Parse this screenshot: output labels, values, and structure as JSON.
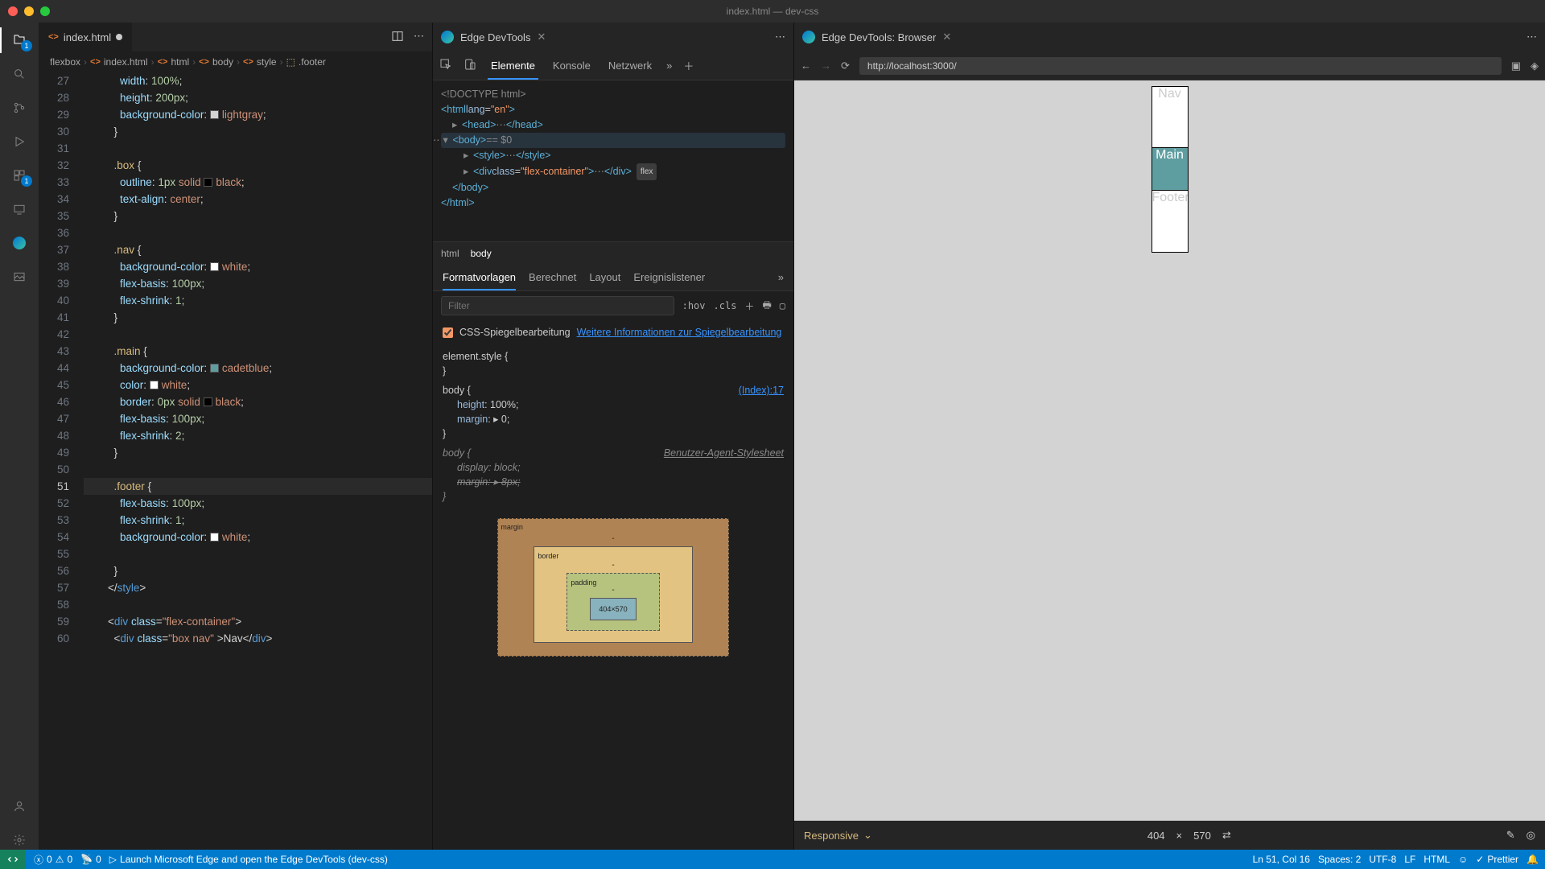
{
  "window": {
    "title": "index.html — dev-css"
  },
  "activity": {
    "explorer_badge": "1",
    "ext_badge": "1"
  },
  "editor": {
    "tab": {
      "icon": "<>",
      "name": "index.html"
    },
    "actions": {
      "split": "▢",
      "more": "⋯"
    },
    "breadcrumbs": [
      "flexbox",
      "index.html",
      "html",
      "body",
      "style",
      ".footer"
    ],
    "lines": [
      {
        "n": 27,
        "html": "            <span class='k'>width</span><span class='p'>: </span><span class='n'>100%</span><span class='p'>;</span>"
      },
      {
        "n": 28,
        "html": "            <span class='k'>height</span><span class='p'>: </span><span class='n'>200px</span><span class='p'>;</span>"
      },
      {
        "n": 29,
        "html": "            <span class='k'>background-color</span><span class='p'>: </span><span class='sw' style='background:lightgray'></span><span class='cm'>lightgray</span><span class='p'>;</span>"
      },
      {
        "n": 30,
        "html": "          <span class='p'>}</span>"
      },
      {
        "n": 31,
        "html": ""
      },
      {
        "n": 32,
        "html": "          <span class='sel'>.box</span> <span class='p'>{</span>"
      },
      {
        "n": 33,
        "html": "            <span class='k'>outline</span><span class='p'>: </span><span class='n'>1px</span> <span class='cm'>solid</span> <span class='sw' style='background:black'></span><span class='cm'>black</span><span class='p'>;</span>"
      },
      {
        "n": 34,
        "html": "            <span class='k'>text-align</span><span class='p'>: </span><span class='cm'>center</span><span class='p'>;</span>"
      },
      {
        "n": 35,
        "html": "          <span class='p'>}</span>"
      },
      {
        "n": 36,
        "html": ""
      },
      {
        "n": 37,
        "html": "          <span class='sel'>.nav</span> <span class='p'>{</span>"
      },
      {
        "n": 38,
        "html": "            <span class='k'>background-color</span><span class='p'>: </span><span class='sw' style='background:white'></span><span class='cm'>white</span><span class='p'>;</span>"
      },
      {
        "n": 39,
        "html": "            <span class='k'>flex-basis</span><span class='p'>: </span><span class='n'>100px</span><span class='p'>;</span>"
      },
      {
        "n": 40,
        "html": "            <span class='k'>flex-shrink</span><span class='p'>: </span><span class='n'>1</span><span class='p'>;</span>"
      },
      {
        "n": 41,
        "html": "          <span class='p'>}</span>"
      },
      {
        "n": 42,
        "html": ""
      },
      {
        "n": 43,
        "html": "          <span class='sel'>.main</span> <span class='p'>{</span>"
      },
      {
        "n": 44,
        "html": "            <span class='k'>background-color</span><span class='p'>: </span><span class='sw' style='background:cadetblue'></span><span class='cm'>cadetblue</span><span class='p'>;</span>"
      },
      {
        "n": 45,
        "html": "            <span class='k'>color</span><span class='p'>: </span><span class='sw' style='background:white'></span><span class='cm'>white</span><span class='p'>;</span>"
      },
      {
        "n": 46,
        "html": "            <span class='k'>border</span><span class='p'>: </span><span class='n'>0px</span> <span class='cm'>solid</span> <span class='sw' style='background:black'></span><span class='cm'>black</span><span class='p'>;</span>"
      },
      {
        "n": 47,
        "html": "            <span class='k'>flex-basis</span><span class='p'>: </span><span class='n'>100px</span><span class='p'>;</span>"
      },
      {
        "n": 48,
        "html": "            <span class='k'>flex-shrink</span><span class='p'>: </span><span class='n'>2</span><span class='p'>;</span>"
      },
      {
        "n": 49,
        "html": "          <span class='p'>}</span>"
      },
      {
        "n": 50,
        "html": ""
      },
      {
        "n": 51,
        "html": "          <span class='sel'>.footer</span> <span class='p'>{</span>",
        "cur": true
      },
      {
        "n": 52,
        "html": "            <span class='k'>flex-basis</span><span class='p'>: </span><span class='n'>100px</span><span class='p'>;</span>"
      },
      {
        "n": 53,
        "html": "            <span class='k'>flex-shrink</span><span class='p'>: </span><span class='n'>1</span><span class='p'>;</span>"
      },
      {
        "n": 54,
        "html": "            <span class='k'>background-color</span><span class='p'>: </span><span class='sw' style='background:white'></span><span class='cm'>white</span><span class='p'>;</span>"
      },
      {
        "n": 55,
        "html": ""
      },
      {
        "n": 56,
        "html": "          <span class='p'>}</span>"
      },
      {
        "n": 57,
        "html": "        <span class='p'>&lt;/</span><span class='tag'>style</span><span class='p'>&gt;</span>"
      },
      {
        "n": 58,
        "html": ""
      },
      {
        "n": 59,
        "html": "        <span class='p'>&lt;</span><span class='tag'>div</span> <span class='k'>class</span><span class='p'>=</span><span class='s'>\"flex-container\"</span><span class='p'>&gt;</span>"
      },
      {
        "n": 60,
        "html": "          <span class='p'>&lt;</span><span class='tag'>div</span> <span class='k'>class</span><span class='p'>=</span><span class='s'>\"box nav\"</span> <span class='p'>&gt;</span>Nav<span class='p'>&lt;/</span><span class='tag'>div</span><span class='p'>&gt;</span>"
      }
    ]
  },
  "devtools": {
    "tab_title": "Edge DevTools",
    "tabs": [
      "Elemente",
      "Konsole",
      "Netzwerk"
    ],
    "active_tab": 0,
    "dom": {
      "doctype": "<!DOCTYPE html>",
      "html_open": "<html lang=\"en\">",
      "head": "<head> ⋯ </head>",
      "body_open": "<body>",
      "body_meta": "== $0",
      "style": "<style> ⋯ </style>",
      "div": "<div class=\"flex-container\"> ⋯ </div>",
      "flex_chip": "flex",
      "body_close": "</body>",
      "html_close": "</html>"
    },
    "crumbs": [
      "html",
      "body"
    ],
    "styles_tabs": [
      "Formatvorlagen",
      "Berechnet",
      "Layout",
      "Ereignislistener"
    ],
    "filter_placeholder": "Filter",
    "hov": ":hov",
    "cls": ".cls",
    "mirror": {
      "label": "CSS-Spiegelbearbeitung",
      "link": "Weitere Informationen zur Spiegelbearbeitung"
    },
    "rules": {
      "element_style": "element.style {",
      "body": "body {",
      "body_src": "(Index):17",
      "height": "height: 100%;",
      "margin": "margin: ▸ 0;",
      "ua_label": "Benutzer-Agent-Stylesheet",
      "ua_body": "body {",
      "display": "display: block;",
      "ua_margin": "margin: ▸ 8px;"
    },
    "boxmodel": {
      "margin": "margin",
      "border": "border",
      "padding": "padding",
      "content": "404×570",
      "dash": "-"
    }
  },
  "browser": {
    "tab_title": "Edge DevTools: Browser",
    "url": "http://localhost:3000/",
    "preview": {
      "nav": "Nav",
      "main": "Main",
      "footer": "Footer"
    },
    "viewbar": {
      "mode": "Responsive",
      "w": "404",
      "h": "570",
      "x": "×"
    }
  },
  "status": {
    "errors": "0",
    "warnings": "0",
    "port": "0",
    "launch": "Launch Microsoft Edge and open the Edge DevTools (dev-css)",
    "cursor": "Ln 51, Col 16",
    "spaces": "Spaces: 2",
    "encoding": "UTF-8",
    "eol": "LF",
    "lang": "HTML",
    "prettier": "Prettier"
  }
}
